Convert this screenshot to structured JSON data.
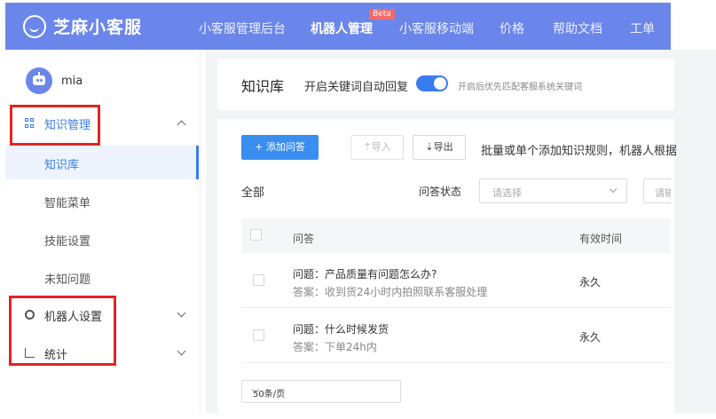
{
  "header": {
    "logo_text": "芝麻小客服",
    "nav": [
      {
        "label": "小客服管理后台"
      },
      {
        "label": "机器人管理",
        "badge": "Beta"
      },
      {
        "label": "小客服移动端"
      },
      {
        "label": "价格"
      },
      {
        "label": "帮助文档"
      },
      {
        "label": "工单"
      }
    ],
    "active_nav": "机器人管理"
  },
  "user": {
    "name": "mia"
  },
  "sidebar": {
    "groups": [
      {
        "label": "知识管理",
        "icon": "grid-icon",
        "expanded": true,
        "items": [
          {
            "label": "知识库",
            "active": true
          },
          {
            "label": "智能菜单"
          },
          {
            "label": "技能设置"
          },
          {
            "label": "未知问题"
          }
        ]
      },
      {
        "label": "机器人设置",
        "icon": "gear-icon",
        "expanded": false
      },
      {
        "label": "统计",
        "icon": "chart-icon",
        "expanded": false
      }
    ]
  },
  "page": {
    "title": "知识库",
    "auto_reply_label": "开启关键词自动回复",
    "auto_reply_enabled": true,
    "auto_reply_hint": "开启后优先匹配客服系统关键词"
  },
  "toolbar": {
    "add_label": "+ 添加问答",
    "import_label": "⇡导入",
    "export_label": "⇣导出",
    "batch_text": "批量或单个添加知识规则，机器人根据"
  },
  "filters": {
    "all_label": "全部",
    "status_label": "问答状态",
    "status_placeholder": "请选择",
    "second_placeholder": "请输"
  },
  "table": {
    "columns": [
      "问答",
      "有效时间"
    ],
    "rows": [
      {
        "question": "问题：产品质量有问题怎么办?",
        "answer": "答案：收到货24小时内拍照联系客服处理",
        "valid": "永久"
      },
      {
        "question": "问题：什么时候发货",
        "answer": "答案：下单24h内",
        "valid": "永久"
      }
    ]
  },
  "pagination": {
    "page_size": "50条/页"
  },
  "colors": {
    "brand": "#6b86eb",
    "accent": "#3a7bef",
    "highlight": "#e02424"
  }
}
